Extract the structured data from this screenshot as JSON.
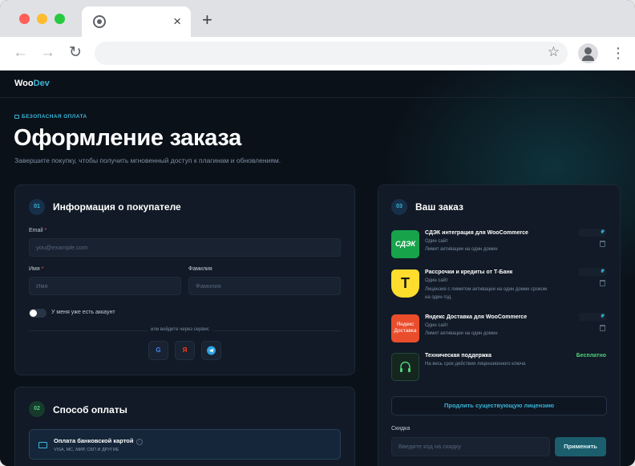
{
  "browser": {
    "tab_close": "×",
    "new_tab": "+",
    "back": "←",
    "forward": "→",
    "reload": "↻",
    "star": "☆",
    "menu": "⋮"
  },
  "site": {
    "logo_part1": "Woo",
    "logo_part2": "Dev"
  },
  "header": {
    "secure_label": "БЕЗОПАСНАЯ ОПЛАТА",
    "title": "Оформление заказа",
    "subtitle": "Завершите покупку, чтобы получить мгновенный доступ к плагинам и обновлениям."
  },
  "customer": {
    "step": "01",
    "title": "Информация о покупателе",
    "email_label": "Email",
    "email_placeholder": "you@example.com",
    "first_name_label": "Имя",
    "first_name_placeholder": "Имя",
    "last_name_label": "Фамилия",
    "last_name_placeholder": "Фамилия",
    "account_toggle_label": "У меня уже есть аккаунт",
    "or_service": "или войдите через сервис",
    "services": [
      "G",
      "Я"
    ],
    "required_mark": "*"
  },
  "payment": {
    "step": "02",
    "title": "Способ оплаты",
    "option_title": "Оплата банковской картой",
    "option_info": "i",
    "option_sub": "VISA, MC, МИР, СБП И ДРУГИЕ"
  },
  "order": {
    "step": "03",
    "title": "Ваш заказ",
    "items": [
      {
        "name": "СДЭК интеграция для WooCommerce",
        "sub1": "Один сайт",
        "sub2": "Лимит активации на один домен",
        "price": "₽",
        "logo": "СДЭК"
      },
      {
        "name": "Рассрочки и кредиты от Т-Банк",
        "sub1": "Один сайт",
        "sub2": "Лицензия с лимитом активации на один домен сроком",
        "sub3": "на один год.",
        "price": "₽",
        "logo": "Т"
      },
      {
        "name": "Яндекс Доставка для WooCommerce",
        "sub1": "Один сайт",
        "sub2": "Лимит активации на один домен",
        "price": "₽",
        "logo_line1": "Яндекс",
        "logo_line2": "Доставка"
      },
      {
        "name": "Техническая поддержка",
        "sub1": "На весь срок действия лицензионного ключа",
        "price": "Бесплатно"
      }
    ],
    "renew_label": "Продлить существующую лицензию",
    "discount_label": "Скидка",
    "discount_placeholder": "Введите код на скидку",
    "apply_label": "Применить"
  },
  "colors": {
    "accent": "#38b6d8",
    "free": "#4fd07c",
    "cdek": "#16a34a",
    "tbank": "#ffdd2d",
    "yandex": "#ea4d2c"
  }
}
